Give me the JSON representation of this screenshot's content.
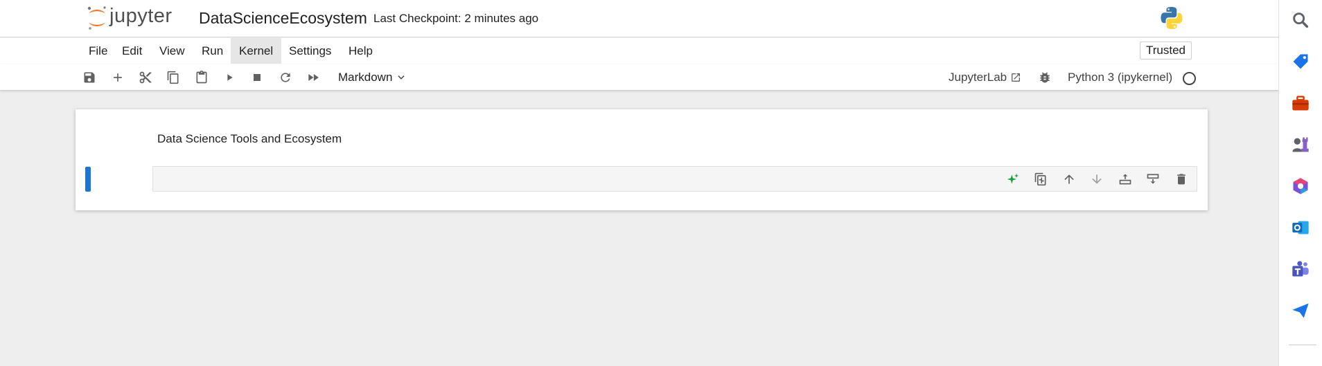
{
  "header": {
    "logo_text": "jupyter",
    "notebook_title": "DataScienceEcosystem",
    "checkpoint": "Last Checkpoint: 2 minutes ago"
  },
  "menubar": {
    "items": [
      "File",
      "Edit",
      "View",
      "Run",
      "Kernel",
      "Settings",
      "Help"
    ],
    "active": "Kernel",
    "trusted": "Trusted"
  },
  "toolbar": {
    "cell_type": "Markdown",
    "jupyterlab_link": "JupyterLab",
    "kernel": "Python 3 (ipykernel)",
    "kernel_status": "idle"
  },
  "notebook": {
    "cells": [
      {
        "type": "markdown",
        "rendered_text": "Data Science Tools and Ecosystem"
      },
      {
        "type": "code",
        "source": ""
      }
    ]
  },
  "colors": {
    "accent": "#1976d2",
    "background": "#eeeeee",
    "jupyter_orange": "#f37726",
    "sparkle_green": "#1a9e3a"
  }
}
